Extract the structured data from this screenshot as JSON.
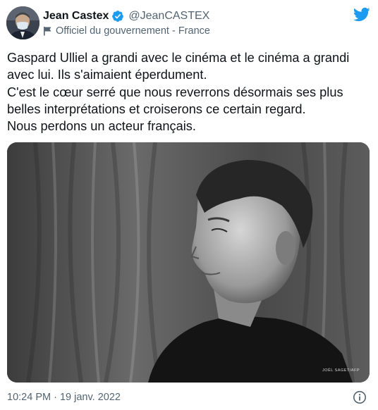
{
  "author": {
    "display_name": "Jean Castex",
    "handle": "@JeanCASTEX",
    "verified": true,
    "label": "Officiel du gouvernement - France",
    "avatar_icon": "person-avatar"
  },
  "tweet": {
    "lines": [
      "Gaspard Ulliel a grandi avec le cinéma et le cinéma a grandi",
      "avec lui. Ils s'aimaient éperdument.",
      "C'est le cœur serré que nous reverrons désormais ses plus",
      "belles interprétations et croiserons ce certain regard.",
      "Nous perdons un acteur français."
    ]
  },
  "media": {
    "photo_credit": "JOËL SAGET/AFP"
  },
  "footer": {
    "timestamp": "10:24 PM · 19 janv. 2022"
  },
  "colors": {
    "text": "#0f1419",
    "secondary": "#536471",
    "twitter_blue": "#1d9bf0"
  }
}
